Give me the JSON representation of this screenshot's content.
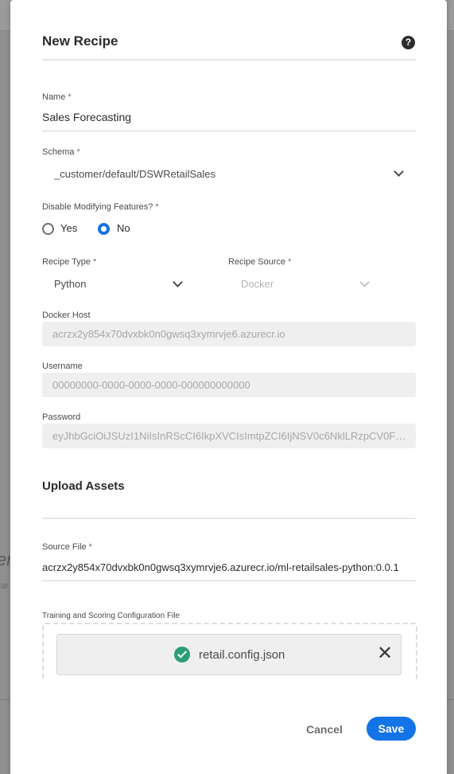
{
  "dialog": {
    "title": "New Recipe",
    "help_icon": "question-circle-icon"
  },
  "fields": {
    "name": {
      "label": "Name",
      "required_mark": "*",
      "value": "Sales Forecasting"
    },
    "schema": {
      "label": "Schema",
      "required_mark": "*",
      "value": "_customer/default/DSWRetailSales"
    },
    "disable_modifying": {
      "label": "Disable Modifying Features?",
      "required_mark": "*",
      "options": [
        "Yes",
        "No"
      ],
      "selected": "No"
    },
    "recipe_type": {
      "label": "Recipe Type",
      "required_mark": "*",
      "value": "Python"
    },
    "recipe_source": {
      "label": "Recipe Source",
      "required_mark": "*",
      "value": "Docker"
    },
    "docker_host": {
      "label": "Docker Host",
      "value": "acrzx2y854x70dvxbk0n0gwsq3xymrvje6.azurecr.io"
    },
    "username": {
      "label": "Username",
      "value": "00000000-0000-0000-0000-000000000000"
    },
    "password": {
      "label": "Password",
      "value": "eyJhbGciOiJSUzI1NiIsInRScCI6IkpXVCIsImtpZCI6IjNSV0c6NklLRzpCV0FGOjN..."
    }
  },
  "upload": {
    "section_title": "Upload Assets",
    "source_file": {
      "label": "Source File",
      "required_mark": "*",
      "value": "acrzx2y854x70dvxbk0n0gwsq3xymrvje6.azurecr.io/ml-retailsales-python:0.0.1"
    },
    "config_file": {
      "label": "Training and Scoring Configuration File",
      "file_name": "retail.config.json",
      "status_icon": "check-circle-icon",
      "remove_icon": "close-icon"
    }
  },
  "actions": {
    "cancel": "Cancel",
    "save": "Save"
  },
  "background": {
    "partial_text": "er",
    "partial_sub": "tar"
  },
  "colors": {
    "accent": "#1473e6",
    "success": "#2d9d78"
  }
}
